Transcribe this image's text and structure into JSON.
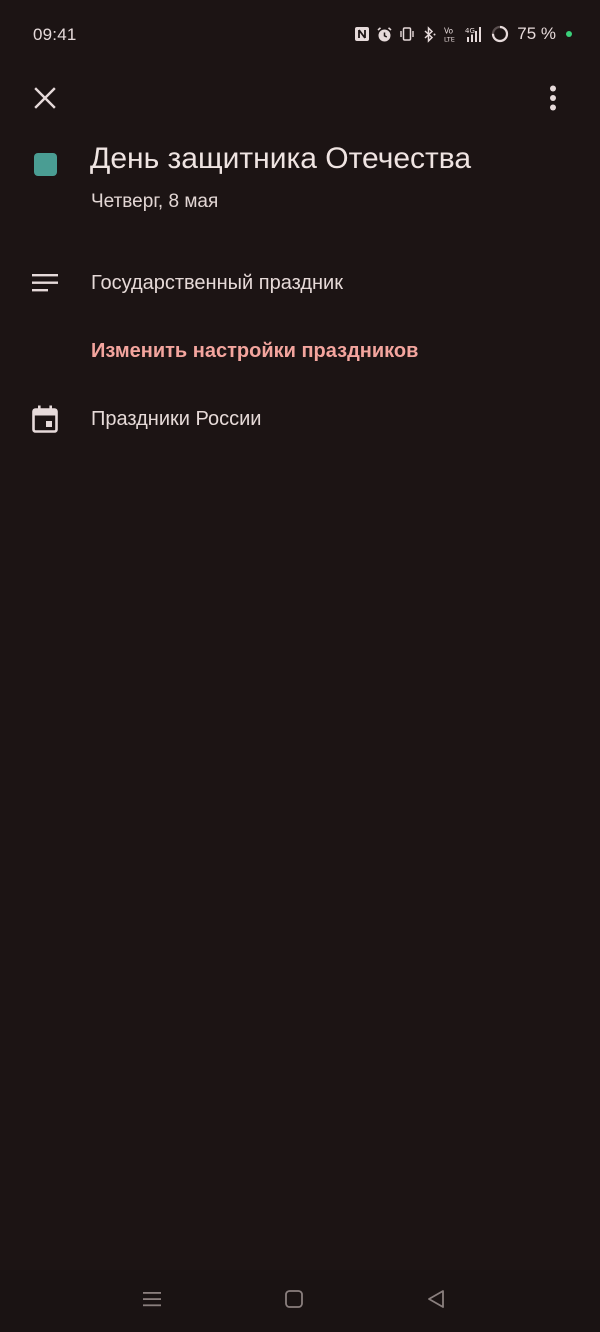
{
  "status_bar": {
    "time": "09:41",
    "battery": "75 %",
    "icons": [
      "nfc-icon",
      "alarm-icon",
      "vibrate-icon",
      "bluetooth-icon",
      "volte-icon",
      "signal-4g-icon",
      "battery-ring-icon"
    ],
    "battery_dot_color": "#3ad07a"
  },
  "toolbar": {
    "close_icon": "close-icon",
    "more_icon": "more-vert-icon"
  },
  "event": {
    "color": "#4a9d93",
    "title": "День защитника Отечества",
    "date": "Четверг, 8 мая"
  },
  "details": {
    "description_icon": "notes-icon",
    "description": "Государственный праздник",
    "settings_link": "Изменить настройки праздников",
    "calendar_icon": "calendar-event-icon",
    "calendar_name": "Праздники России"
  },
  "nav": {
    "menu_icon": "menu-icon",
    "home_icon": "home-square-icon",
    "back_icon": "back-triangle-icon"
  },
  "colors": {
    "background": "#1c1414",
    "link": "#f3a59e",
    "text": "#ece0de"
  }
}
